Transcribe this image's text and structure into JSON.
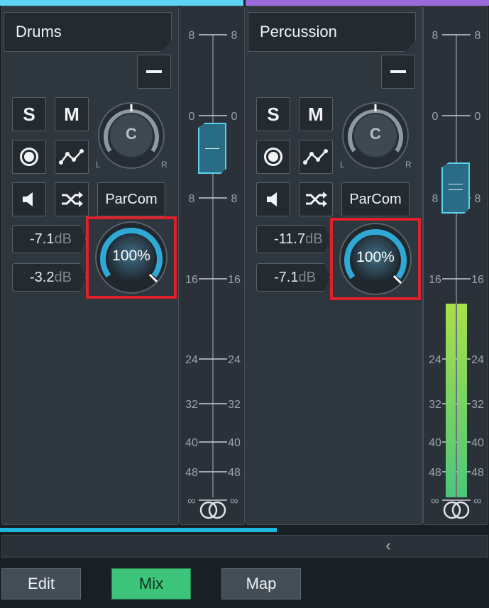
{
  "colors": {
    "drums_stripe": "#5fd5f5",
    "percussion_stripe": "#9b6bde",
    "accent_blue": "#2fa8d6",
    "meter_green": "#5bd07a",
    "highlight_red": "#e0202a",
    "mix_active": "#3cc47a"
  },
  "channels": [
    {
      "name": "Drums",
      "solo": "S",
      "mute": "M",
      "pan": "C",
      "pan_left": "L",
      "pan_right": "R",
      "send_label": "ParCom",
      "level1": "-7.1",
      "level2": "-3.2",
      "unit": "dB",
      "wet": "100%",
      "fader_db": 0,
      "meter_level": 0
    },
    {
      "name": "Percussion",
      "solo": "S",
      "mute": "M",
      "pan": "C",
      "pan_left": "L",
      "pan_right": "R",
      "send_label": "ParCom",
      "level1": "-11.7",
      "level2": "-7.1",
      "unit": "dB",
      "wet": "100%",
      "fader_db": 8,
      "meter_level": 0.62
    }
  ],
  "scale_ticks": [
    "8",
    "0",
    "8",
    "16",
    "24",
    "32",
    "40",
    "48",
    "∞"
  ],
  "footer": {
    "edit": "Edit",
    "mix": "Mix",
    "map": "Map",
    "scroll_left": "‹"
  }
}
